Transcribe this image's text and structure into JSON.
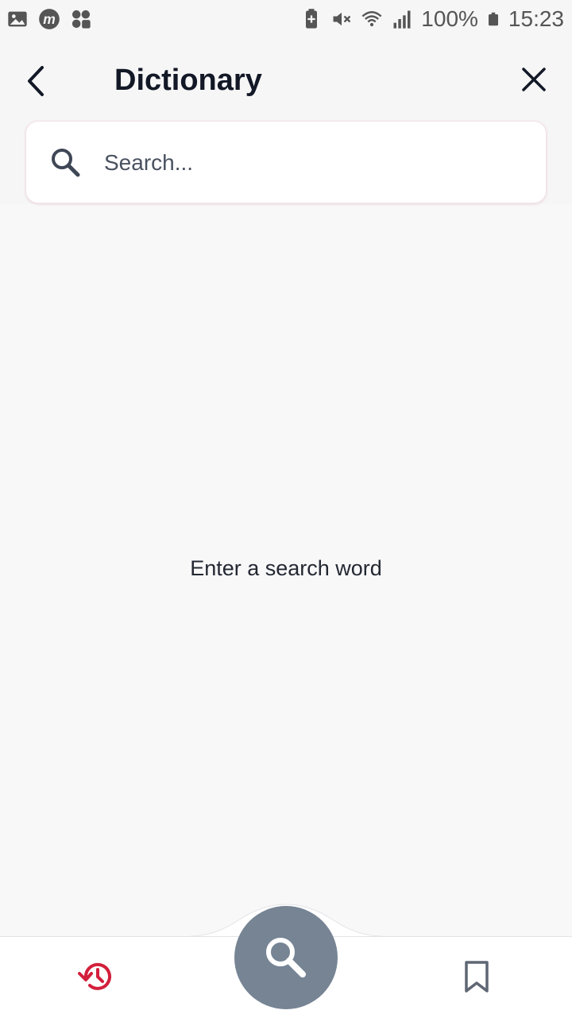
{
  "status_bar": {
    "battery": "100%",
    "time": "15:23",
    "icons": [
      "gallery-icon",
      "m-app-icon",
      "apps-icon",
      "battery-saver-icon",
      "mute-icon",
      "wifi-icon",
      "signal-icon",
      "battery-icon"
    ]
  },
  "header": {
    "title": "Dictionary",
    "back_icon": "chevron-left-icon",
    "close_icon": "close-icon"
  },
  "search": {
    "placeholder": "Search...",
    "value": ""
  },
  "main": {
    "empty_message": "Enter a search word"
  },
  "bottom_nav": {
    "items": [
      "history-icon",
      "search-icon",
      "bookmark-icon"
    ],
    "active_color": "#d21f3c",
    "fab_color": "#768494"
  }
}
